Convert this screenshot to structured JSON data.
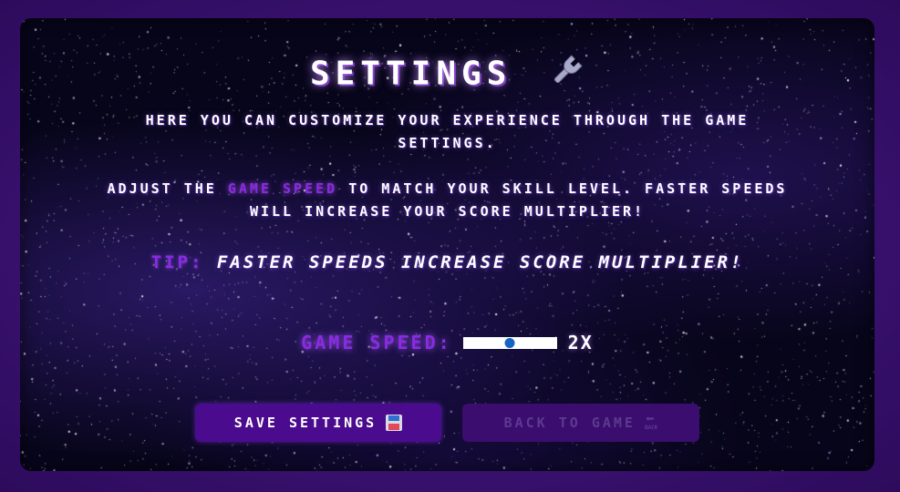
{
  "settings": {
    "title": "SETTINGS",
    "title_icon": "wrench-icon",
    "intro": "HERE YOU CAN CUSTOMIZE YOUR EXPERIENCE THROUGH THE GAME SETTINGS.",
    "adjust_prefix": "ADJUST THE ",
    "adjust_highlight": "GAME SPEED",
    "adjust_suffix": " TO MATCH YOUR SKILL LEVEL. FASTER SPEEDS WILL INCREASE YOUR SCORE MULTIPLIER!",
    "tip_label": "TIP:",
    "tip_text": "FASTER SPEEDS INCREASE SCORE MULTIPLIER!",
    "speed_label": "GAME SPEED:",
    "speed_value": "2X",
    "speed_fraction": 0.5
  },
  "buttons": {
    "save_label": "SAVE SETTINGS",
    "save_icon": "floppy-disk-icon",
    "back_label": "BACK TO GAME",
    "back_icon": "back-arrow-icon",
    "back_icon_text": "BACK"
  },
  "colors": {
    "accent": "#8a2be2",
    "frame": "#3a0f6e",
    "save_button_bg": "#4a0b8e",
    "back_button_bg": "#3a0d6e",
    "slider_thumb": "#1565c0"
  }
}
